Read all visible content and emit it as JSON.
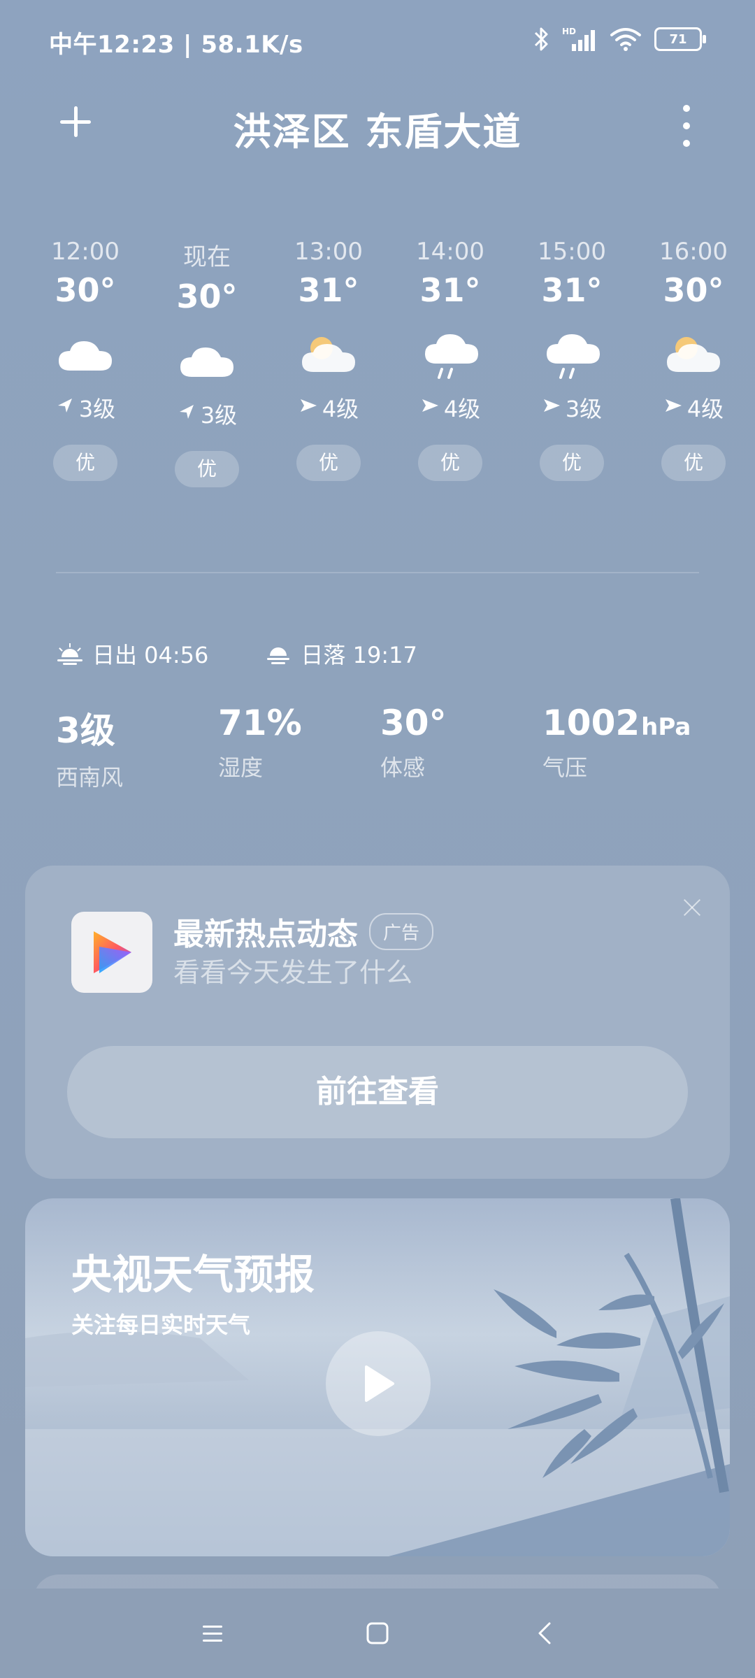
{
  "status_bar": {
    "time_speed": "中午12:23 | 58.1K/s",
    "battery": "71",
    "icons": [
      "bluetooth-icon",
      "hd-signal-icon",
      "wifi-icon",
      "battery-icon"
    ]
  },
  "header": {
    "title": "洪泽区 东盾大道"
  },
  "hourly": [
    {
      "time": "12:00",
      "temp": "30°",
      "icon": "cloudy",
      "wind": "3级",
      "wind_dir": "northeast",
      "aqi": "优"
    },
    {
      "time": "现在",
      "temp": "30°",
      "icon": "cloudy",
      "wind": "3级",
      "wind_dir": "northeast",
      "aqi": "优"
    },
    {
      "time": "13:00",
      "temp": "31°",
      "icon": "partly-cloudy",
      "wind": "4级",
      "wind_dir": "east",
      "aqi": "优"
    },
    {
      "time": "14:00",
      "temp": "31°",
      "icon": "rain",
      "wind": "4级",
      "wind_dir": "east",
      "aqi": "优"
    },
    {
      "time": "15:00",
      "temp": "31°",
      "icon": "rain",
      "wind": "3级",
      "wind_dir": "east",
      "aqi": "优"
    },
    {
      "time": "16:00",
      "temp": "30°",
      "icon": "partly-cloudy",
      "wind": "4级",
      "wind_dir": "east",
      "aqi": "优"
    }
  ],
  "sun": {
    "sunrise_label": "日出 04:56",
    "sunset_label": "日落 19:17"
  },
  "details": [
    {
      "value": "3级",
      "unit": "",
      "label": "西南风"
    },
    {
      "value": "71%",
      "unit": "",
      "label": "湿度"
    },
    {
      "value": "30°",
      "unit": "",
      "label": "体感"
    },
    {
      "value": "1002",
      "unit": "hPa",
      "label": "气压"
    }
  ],
  "ad": {
    "title": "最新热点动态",
    "badge": "广告",
    "subtitle": "看看今天发生了什么",
    "cta": "前往查看"
  },
  "video": {
    "title": "央视天气预报",
    "subtitle": "关注每日实时天气"
  }
}
